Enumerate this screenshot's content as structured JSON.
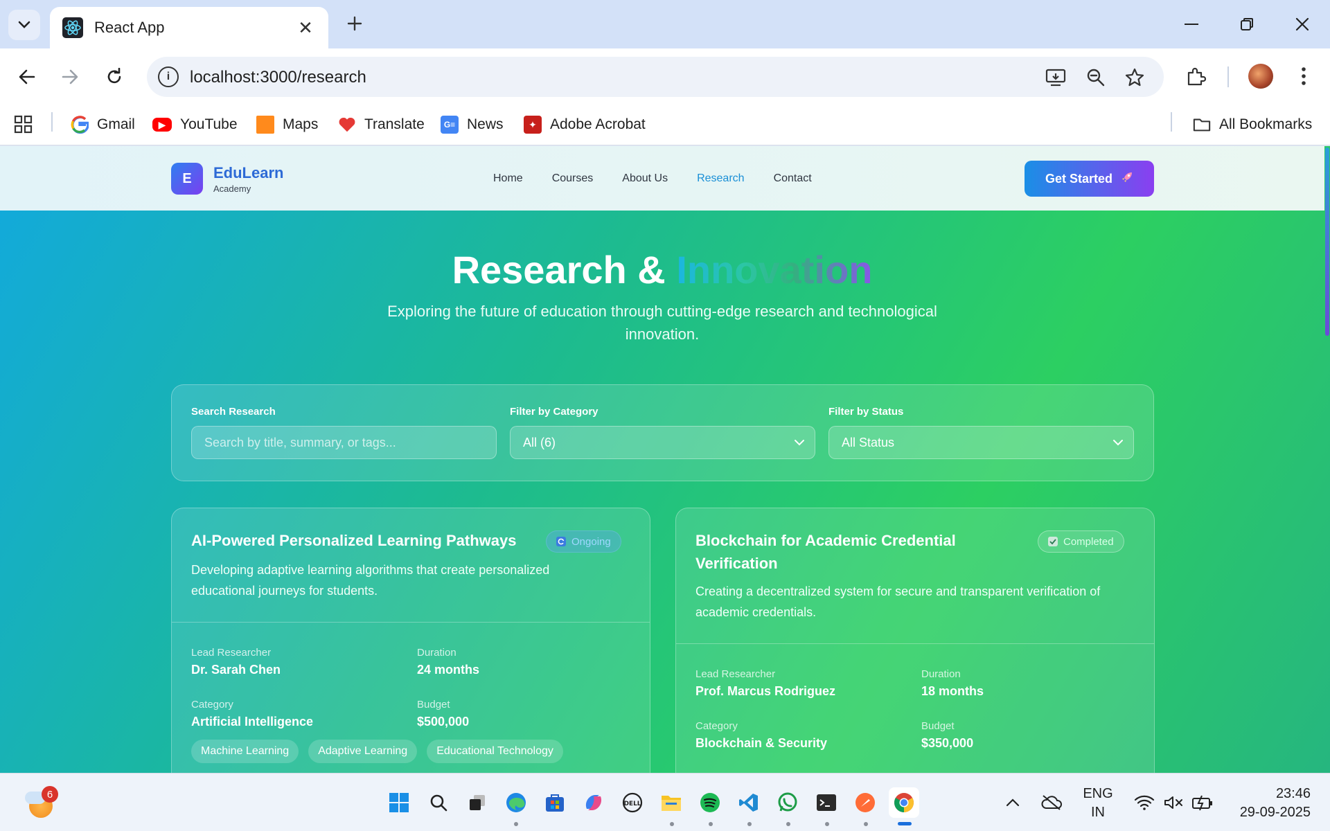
{
  "browser": {
    "tab_title": "React App",
    "url": "localhost:3000/research",
    "bookmarks": [
      {
        "label": "Gmail",
        "icon": "gmail-icon"
      },
      {
        "label": "YouTube",
        "icon": "youtube-icon"
      },
      {
        "label": "Maps",
        "icon": "maps-icon"
      },
      {
        "label": "Translate",
        "icon": "translate-icon"
      },
      {
        "label": "News",
        "icon": "news-icon"
      },
      {
        "label": "Adobe Acrobat",
        "icon": "acrobat-icon"
      }
    ],
    "all_bookmarks": "All Bookmarks"
  },
  "site": {
    "logo_letter": "E",
    "logo_name": "EduLearn",
    "logo_sub": "Academy",
    "nav": [
      "Home",
      "Courses",
      "About Us",
      "Research",
      "Contact"
    ],
    "active_nav": "Research",
    "cta_label": "Get Started",
    "cta_icon": "rocket-icon"
  },
  "hero": {
    "title_plain": "Research & ",
    "title_highlight": "Innovation",
    "subtitle": "Exploring the future of education through cutting-edge research and technological innovation."
  },
  "filters": {
    "search_label": "Search Research",
    "search_placeholder": "Search by title, summary, or tags...",
    "category_label": "Filter by Category",
    "category_value": "All (6)",
    "status_label": "Filter by Status",
    "status_value": "All Status"
  },
  "cards": [
    {
      "title": "AI-Powered Personalized Learning Pathways",
      "status": "Ongoing",
      "summary": "Developing adaptive learning algorithms that create personalized educational journeys for students.",
      "lead_label": "Lead Researcher",
      "lead": "Dr. Sarah Chen",
      "duration_label": "Duration",
      "duration": "24 months",
      "category_label": "Category",
      "category": "Artificial Intelligence",
      "budget_label": "Budget",
      "budget": "$500,000",
      "tags": [
        "Machine Learning",
        "Adaptive Learning",
        "Educational Technology"
      ]
    },
    {
      "title": "Blockchain for Academic Credential Verification",
      "status": "Completed",
      "summary": "Creating a decentralized system for secure and transparent verification of academic credentials.",
      "lead_label": "Lead Researcher",
      "lead": "Prof. Marcus Rodriguez",
      "duration_label": "Duration",
      "duration": "18 months",
      "category_label": "Category",
      "category": "Blockchain & Security",
      "budget_label": "Budget",
      "budget": "$350,000"
    }
  ],
  "taskbar": {
    "weather_badge": "6",
    "language": "ENG",
    "region": "IN",
    "time": "23:46",
    "date": "29-09-2025"
  },
  "colors": {
    "accent": "#1a8fd6",
    "cta_start": "#1a8fe6",
    "cta_end": "#8a3ff0",
    "page_gradient_start": "#12a9de",
    "page_gradient_end": "#2ccf62"
  }
}
